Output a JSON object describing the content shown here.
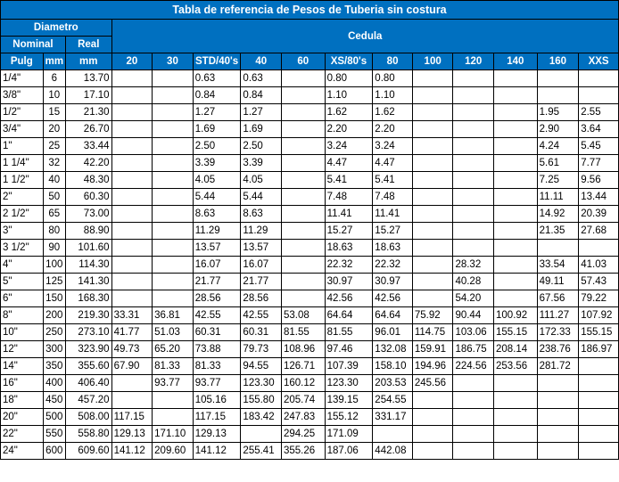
{
  "title": "Tabla de referencia de Pesos de Tuberia sin costura",
  "headers": {
    "diametro": "Diametro",
    "nominal": "Nominal",
    "real": "Real",
    "cedula": "Cedula",
    "pulg": "Pulg",
    "mm": "mm",
    "real_mm": "mm",
    "schedules": [
      "20",
      "30",
      "STD/40's",
      "40",
      "60",
      "XS/80's",
      "80",
      "100",
      "120",
      "140",
      "160",
      "XXS"
    ]
  },
  "rows": [
    {
      "pulg": "1/4\"",
      "mm": "6",
      "real": "13.70",
      "values": [
        "",
        "",
        "0.63",
        "0.63",
        "",
        "0.80",
        "0.80",
        "",
        "",
        "",
        "",
        ""
      ]
    },
    {
      "pulg": "3/8\"",
      "mm": "10",
      "real": "17.10",
      "values": [
        "",
        "",
        "0.84",
        "0.84",
        "",
        "1.10",
        "1.10",
        "",
        "",
        "",
        "",
        ""
      ]
    },
    {
      "pulg": "1/2\"",
      "mm": "15",
      "real": "21.30",
      "values": [
        "",
        "",
        "1.27",
        "1.27",
        "",
        "1.62",
        "1.62",
        "",
        "",
        "",
        "1.95",
        "2.55"
      ]
    },
    {
      "pulg": "3/4\"",
      "mm": "20",
      "real": "26.70",
      "values": [
        "",
        "",
        "1.69",
        "1.69",
        "",
        "2.20",
        "2.20",
        "",
        "",
        "",
        "2.90",
        "3.64"
      ]
    },
    {
      "pulg": "1\"",
      "mm": "25",
      "real": "33.44",
      "values": [
        "",
        "",
        "2.50",
        "2.50",
        "",
        "3.24",
        "3.24",
        "",
        "",
        "",
        "4.24",
        "5.45"
      ]
    },
    {
      "pulg": "1 1/4\"",
      "mm": "32",
      "real": "42.20",
      "values": [
        "",
        "",
        "3.39",
        "3.39",
        "",
        "4.47",
        "4.47",
        "",
        "",
        "",
        "5.61",
        "7.77"
      ]
    },
    {
      "pulg": "1 1/2\"",
      "mm": "40",
      "real": "48.30",
      "values": [
        "",
        "",
        "4.05",
        "4.05",
        "",
        "5.41",
        "5.41",
        "",
        "",
        "",
        "7.25",
        "9.56"
      ]
    },
    {
      "pulg": "2\"",
      "mm": "50",
      "real": "60.30",
      "values": [
        "",
        "",
        "5.44",
        "5.44",
        "",
        "7.48",
        "7.48",
        "",
        "",
        "",
        "11.11",
        "13.44"
      ]
    },
    {
      "pulg": "2 1/2\"",
      "mm": "65",
      "real": "73.00",
      "values": [
        "",
        "",
        "8.63",
        "8.63",
        "",
        "11.41",
        "11.41",
        "",
        "",
        "",
        "14.92",
        "20.39"
      ]
    },
    {
      "pulg": "3\"",
      "mm": "80",
      "real": "88.90",
      "values": [
        "",
        "",
        "11.29",
        "11.29",
        "",
        "15.27",
        "15.27",
        "",
        "",
        "",
        "21.35",
        "27.68"
      ]
    },
    {
      "pulg": "3 1/2\"",
      "mm": "90",
      "real": "101.60",
      "values": [
        "",
        "",
        "13.57",
        "13.57",
        "",
        "18.63",
        "18.63",
        "",
        "",
        "",
        "",
        ""
      ]
    },
    {
      "pulg": "4\"",
      "mm": "100",
      "real": "114.30",
      "values": [
        "",
        "",
        "16.07",
        "16.07",
        "",
        "22.32",
        "22.32",
        "",
        "28.32",
        "",
        "33.54",
        "41.03"
      ]
    },
    {
      "pulg": "5\"",
      "mm": "125",
      "real": "141.30",
      "values": [
        "",
        "",
        "21.77",
        "21.77",
        "",
        "30.97",
        "30.97",
        "",
        "40.28",
        "",
        "49.11",
        "57.43"
      ]
    },
    {
      "pulg": "6\"",
      "mm": "150",
      "real": "168.30",
      "values": [
        "",
        "",
        "28.56",
        "28.56",
        "",
        "42.56",
        "42.56",
        "",
        "54.20",
        "",
        "67.56",
        "79.22"
      ]
    },
    {
      "pulg": "8\"",
      "mm": "200",
      "real": "219.30",
      "values": [
        "33.31",
        "36.81",
        "42.55",
        "42.55",
        "53.08",
        "64.64",
        "64.64",
        "75.92",
        "90.44",
        "100.92",
        "111.27",
        "107.92"
      ]
    },
    {
      "pulg": "10\"",
      "mm": "250",
      "real": "273.10",
      "values": [
        "41.77",
        "51.03",
        "60.31",
        "60.31",
        "81.55",
        "81.55",
        "96.01",
        "114.75",
        "103.06",
        "155.15",
        "172.33",
        "155.15"
      ]
    },
    {
      "pulg": "12\"",
      "mm": "300",
      "real": "323.90",
      "values": [
        "49.73",
        "65.20",
        "73.88",
        "79.73",
        "108.96",
        "97.46",
        "132.08",
        "159.91",
        "186.75",
        "208.14",
        "238.76",
        "186.97"
      ]
    },
    {
      "pulg": "14\"",
      "mm": "350",
      "real": "355.60",
      "values": [
        "67.90",
        "81.33",
        "81.33",
        "94.55",
        "126.71",
        "107.39",
        "158.10",
        "194.96",
        "224.56",
        "253.56",
        "281.72",
        ""
      ]
    },
    {
      "pulg": "16\"",
      "mm": "400",
      "real": "406.40",
      "values": [
        "",
        "93.77",
        "93.77",
        "123.30",
        "160.12",
        "123.30",
        "203.53",
        "245.56",
        "",
        "",
        "",
        ""
      ]
    },
    {
      "pulg": "18\"",
      "mm": "450",
      "real": "457.20",
      "values": [
        "",
        "",
        "105.16",
        "155.80",
        "205.74",
        "139.15",
        "254.55",
        "",
        "",
        "",
        "",
        ""
      ]
    },
    {
      "pulg": "20\"",
      "mm": "500",
      "real": "508.00",
      "values": [
        "117.15",
        "",
        "117.15",
        "183.42",
        "247.83",
        "155.12",
        "331.17",
        "",
        "",
        "",
        "",
        ""
      ]
    },
    {
      "pulg": "22\"",
      "mm": "550",
      "real": "558.80",
      "values": [
        "129.13",
        "171.10",
        "129.13",
        "",
        "294.25",
        "171.09",
        "",
        "",
        "",
        "",
        "",
        ""
      ]
    },
    {
      "pulg": "24\"",
      "mm": "600",
      "real": "609.60",
      "values": [
        "141.12",
        "209.60",
        "141.12",
        "255.41",
        "355.26",
        "187.06",
        "442.08",
        "",
        "",
        "",
        "",
        ""
      ]
    }
  ],
  "colors": {
    "header_bg": "#0070c0",
    "header_text": "#ffffff",
    "border": "#000000"
  }
}
